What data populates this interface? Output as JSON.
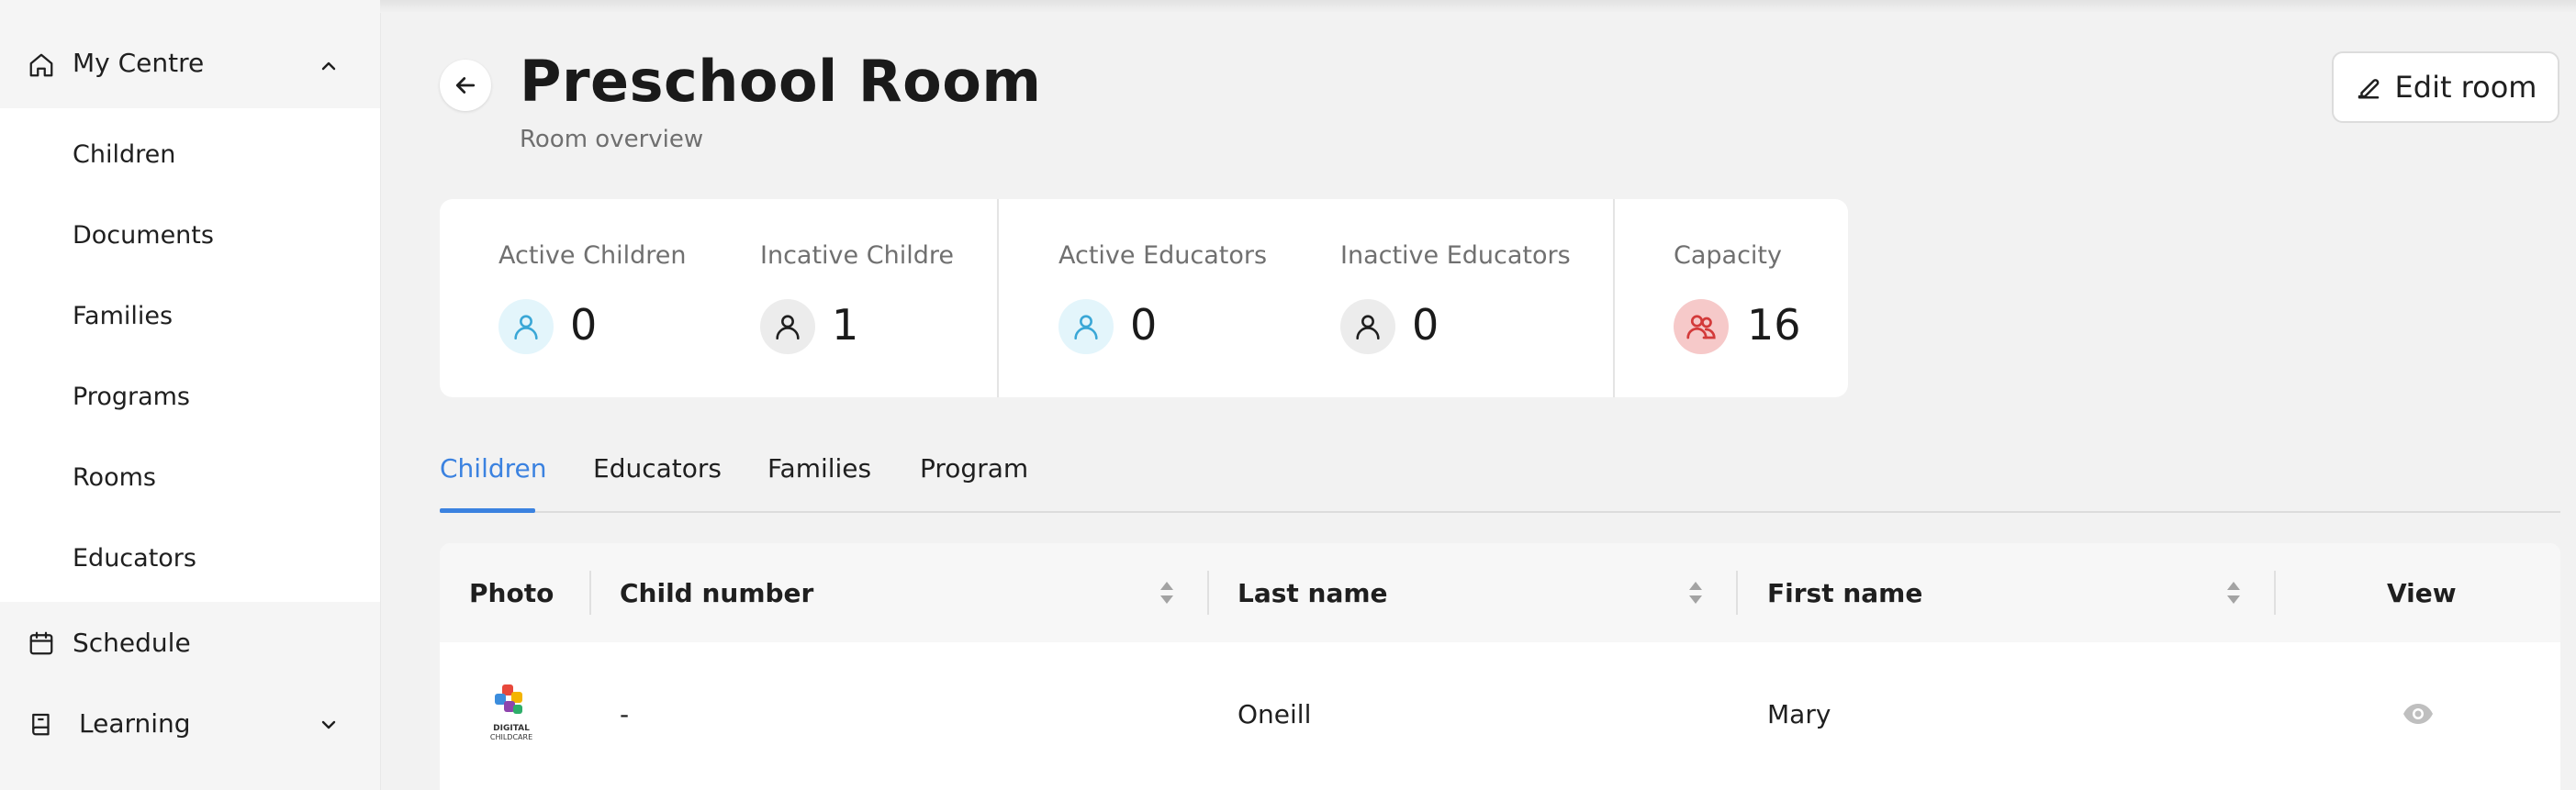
{
  "sidebar": {
    "my_centre": "My Centre",
    "sub_items": [
      "Children",
      "Documents",
      "Families",
      "Programs",
      "Rooms",
      "Educators"
    ],
    "schedule": "Schedule",
    "learning": "Learning"
  },
  "header": {
    "title": "Preschool Room",
    "subtitle": "Room overview",
    "edit_label": "Edit room"
  },
  "stats": {
    "active_children": {
      "label": "Active Children",
      "value": "0"
    },
    "inactive_children": {
      "label": "Incative Childre",
      "value": "1"
    },
    "active_educators": {
      "label": "Active Educators",
      "value": "0"
    },
    "inactive_educators": {
      "label": "Inactive Educators",
      "value": "0"
    },
    "capacity": {
      "label": "Capacity",
      "value": "16"
    }
  },
  "tabs": [
    "Children",
    "Educators",
    "Families",
    "Program"
  ],
  "active_tab": "Children",
  "table": {
    "columns": [
      "Photo",
      "Child number",
      "Last name",
      "First name",
      "View"
    ],
    "rows": [
      {
        "photo_logo": "DIGITAL CHILDCARE",
        "child_number": "-",
        "last_name": "Oneill",
        "first_name": "Mary"
      }
    ]
  },
  "colors": {
    "accent": "#3b82e0",
    "active_icon_bg": "#e3f5fb",
    "active_icon_fg": "#3aa7d6",
    "inactive_icon_bg": "#ececec",
    "capacity_icon_bg": "#f6c9c9",
    "capacity_icon_fg": "#d33a3a"
  },
  "icons": {
    "home": "home-icon",
    "back": "arrow-left-icon",
    "edit": "pencil-icon",
    "schedule": "calendar-icon",
    "learning": "book-icon",
    "view": "eye-icon"
  }
}
